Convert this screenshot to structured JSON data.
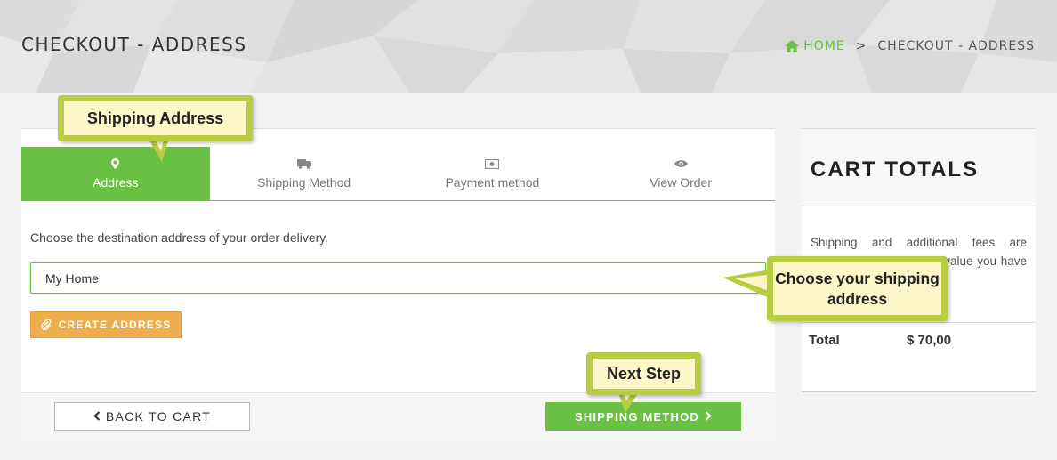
{
  "header": {
    "title": "CHECKOUT - ADDRESS",
    "breadcrumb": {
      "home": "HOME",
      "separator": ">",
      "current": "CHECKOUT - ADDRESS"
    }
  },
  "steps": [
    {
      "label": "Address",
      "icon": "map-marker-icon",
      "active": true
    },
    {
      "label": "Shipping Method",
      "icon": "truck-icon",
      "active": false
    },
    {
      "label": "Payment method",
      "icon": "money-icon",
      "active": false
    },
    {
      "label": "View Order",
      "icon": "eye-icon",
      "active": false
    }
  ],
  "address": {
    "instruction": "Choose the destination address of your order delivery.",
    "selected": "My Home",
    "create_label": "CREATE ADDRESS"
  },
  "footer": {
    "back_label": "BACK TO CART",
    "next_label": "SHIPPING METHOD"
  },
  "cart": {
    "title": "CART TOTALS",
    "note": "Shipping and additional fees are calculated based on the value you have entered",
    "total_label": "Total",
    "total_value": "$ 70,00"
  },
  "tooltips": {
    "shipping_address": "Shipping Address",
    "choose_address": "Choose your shipping address",
    "next_step": "Next Step"
  },
  "colors": {
    "accent": "#6ac043",
    "warning": "#f0ad4e",
    "tooltip_border": "#b8cd44",
    "tooltip_bg": "#fbf7c8"
  }
}
